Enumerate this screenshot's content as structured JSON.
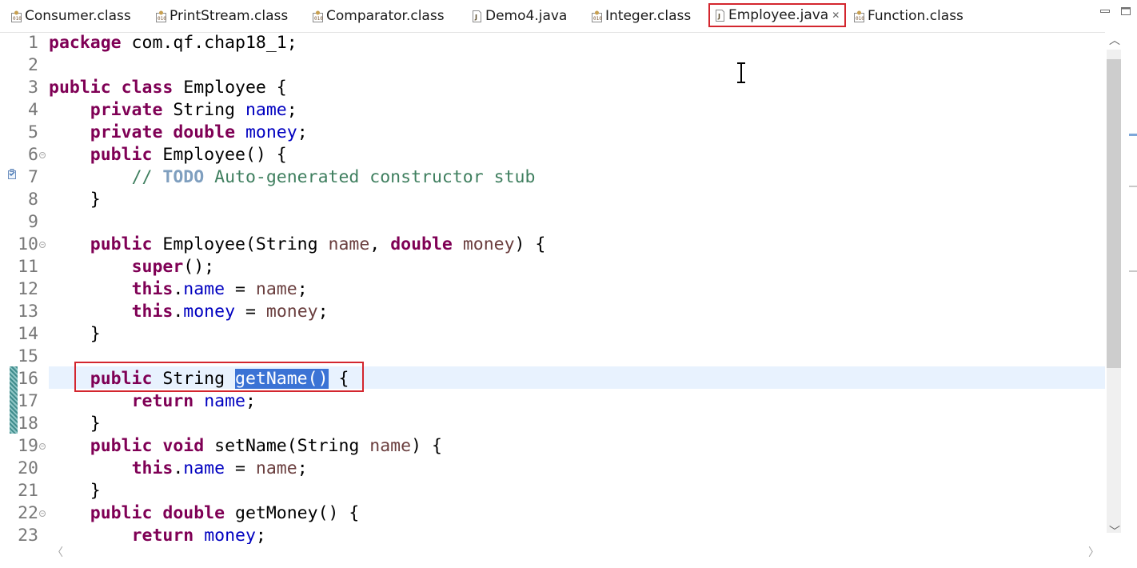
{
  "tabs": [
    {
      "label": "Consumer.class",
      "icon": "class-file-icon"
    },
    {
      "label": "PrintStream.class",
      "icon": "class-file-icon"
    },
    {
      "label": "Comparator.class",
      "icon": "class-file-icon"
    },
    {
      "label": "Demo4.java",
      "icon": "java-file-icon"
    },
    {
      "label": "Integer.class",
      "icon": "class-file-icon"
    },
    {
      "label": "Employee.java",
      "icon": "java-file-icon",
      "active": true,
      "close": "✕"
    },
    {
      "label": "Function.class",
      "icon": "class-file-icon"
    }
  ],
  "window_controls": {
    "minimize": "▭",
    "maximize": "▭"
  },
  "editor": {
    "lines": [
      {
        "n": "1",
        "text": "package com.qf.chap18_1;"
      },
      {
        "n": "2",
        "text": ""
      },
      {
        "n": "3",
        "text": "public class Employee {"
      },
      {
        "n": "4",
        "text": "    private String name;"
      },
      {
        "n": "5",
        "text": "    private double money;"
      },
      {
        "n": "6",
        "text": "    public Employee() {"
      },
      {
        "n": "7",
        "text": "        // TODO Auto-generated constructor stub"
      },
      {
        "n": "8",
        "text": "    }"
      },
      {
        "n": "9",
        "text": ""
      },
      {
        "n": "10",
        "text": "    public Employee(String name, double money) {"
      },
      {
        "n": "11",
        "text": "        super();"
      },
      {
        "n": "12",
        "text": "        this.name = name;"
      },
      {
        "n": "13",
        "text": "        this.money = money;"
      },
      {
        "n": "14",
        "text": "    }"
      },
      {
        "n": "15",
        "text": ""
      },
      {
        "n": "16",
        "text": "    public String getName() {"
      },
      {
        "n": "17",
        "text": "        return name;"
      },
      {
        "n": "18",
        "text": "    }"
      },
      {
        "n": "19",
        "text": "    public void setName(String name) {"
      },
      {
        "n": "20",
        "text": "        this.name = name;"
      },
      {
        "n": "21",
        "text": "    }"
      },
      {
        "n": "22",
        "text": "    public double getMoney() {"
      },
      {
        "n": "23",
        "text": "        return money;"
      }
    ],
    "selected_text": "getName()",
    "highlighted_line": "16"
  },
  "colors": {
    "keyword": "#7f0055",
    "field": "#0000c0",
    "parameter": "#6a3e3e",
    "comment": "#3f7f5f",
    "todo": "#7f9fbf",
    "selection": "#3b73d5",
    "current_line": "#e8f2fe",
    "annotation_box": "#d3262e"
  },
  "scrollbar": {
    "up": "︿",
    "down": "﹀",
    "left": "〈",
    "right": "〉"
  }
}
